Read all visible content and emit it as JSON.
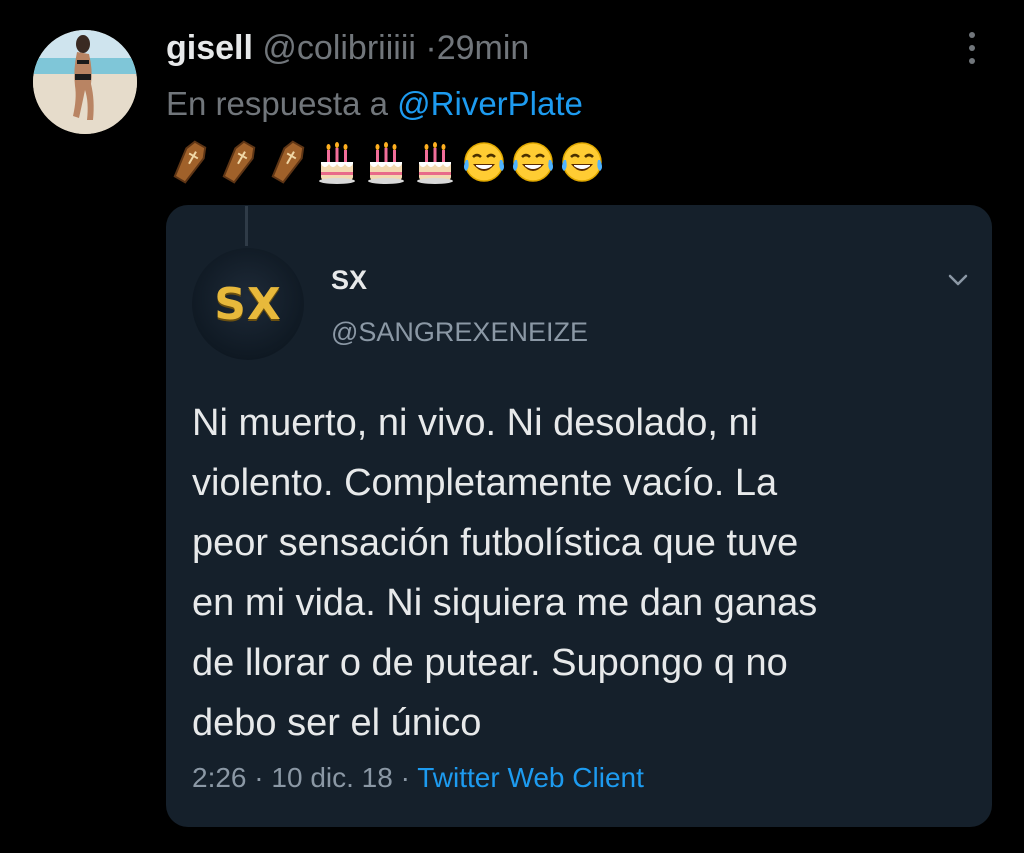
{
  "tweet": {
    "author_name": "gisell",
    "author_handle": "@colibriiiii",
    "separator": "·",
    "time": "29min",
    "reply_prefix": "En respuesta a",
    "reply_to": "@RiverPlate",
    "emojis": [
      "coffin-emoji",
      "coffin-emoji",
      "coffin-emoji",
      "birthday-cake-emoji",
      "birthday-cake-emoji",
      "birthday-cake-emoji",
      "tears-of-joy-emoji",
      "tears-of-joy-emoji",
      "tears-of-joy-emoji"
    ]
  },
  "quoted": {
    "avatar_text": "SX",
    "author_name": "SX",
    "author_handle": "@SANGREXENEIZE",
    "body": "Ni muerto, ni vivo. Ni desolado, ni\nviolento. Completamente vacío. La\npeor sensación futbolística que tuve\nen mi vida. Ni siquiera me dan ganas\nde llorar o de putear.  Supongo q no\ndebo ser el único",
    "time": "2:26",
    "separator": "·",
    "date": "10 dic. 18",
    "source": "Twitter Web Client"
  },
  "colors": {
    "background": "#000000",
    "card": "#15202b",
    "link": "#1d9bf0",
    "muted": "#71767b",
    "avatar_text": "#e8b93b"
  }
}
